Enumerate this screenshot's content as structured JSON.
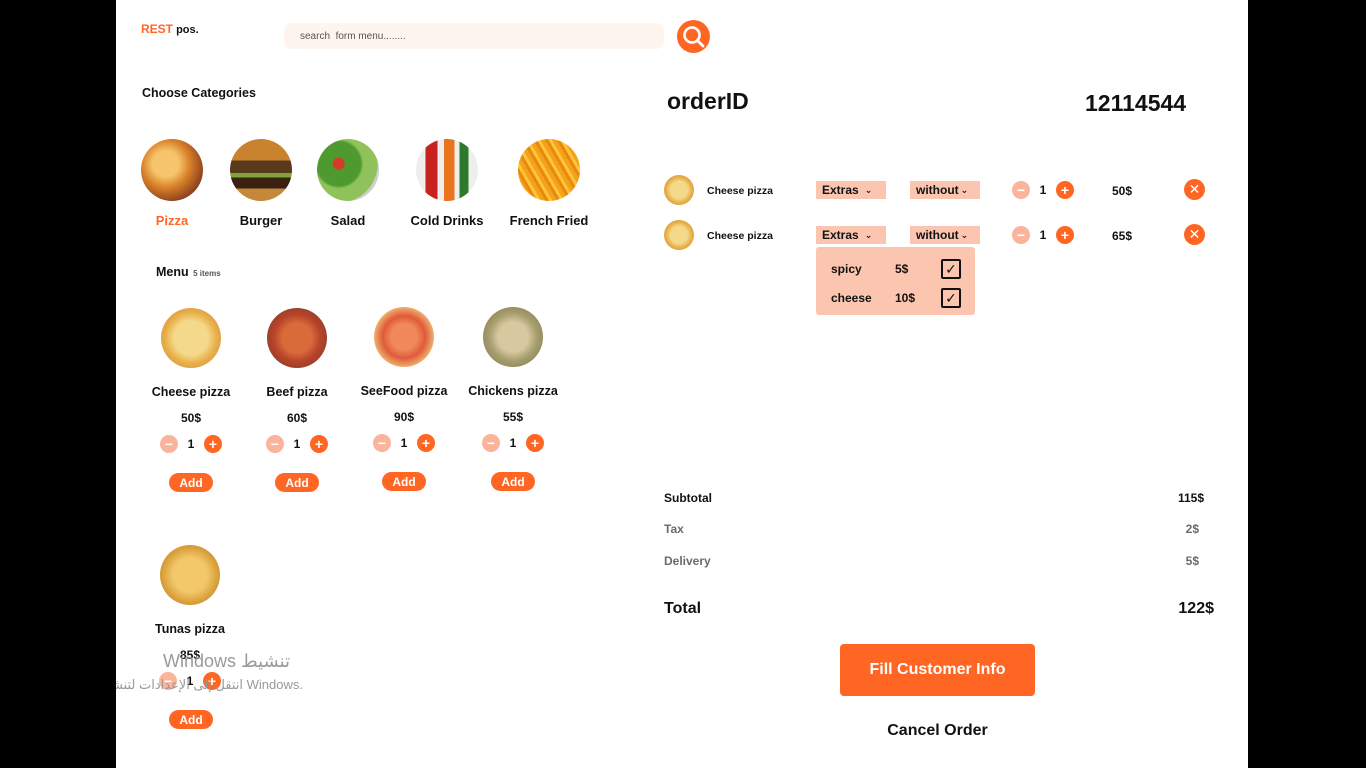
{
  "header": {
    "brand": "REST",
    "brand_suffix": "pos.",
    "search_placeholder": "search  form menu........"
  },
  "categories": {
    "title": "Choose Categories",
    "items": [
      {
        "label": "Pizza",
        "active": true
      },
      {
        "label": "Burger",
        "active": false
      },
      {
        "label": "Salad",
        "active": false
      },
      {
        "label": "Cold Drinks",
        "active": false
      },
      {
        "label": "French Fried",
        "active": false
      }
    ]
  },
  "menu": {
    "title": "Menu",
    "count": "5 items",
    "add_label": "Add",
    "items": [
      {
        "name": "Cheese pizza",
        "price": "50$",
        "qty": "1"
      },
      {
        "name": "Beef pizza",
        "price": "60$",
        "qty": "1"
      },
      {
        "name": "SeeFood pizza",
        "price": "90$",
        "qty": "1"
      },
      {
        "name": "Chickens pizza",
        "price": "55$",
        "qty": "1"
      },
      {
        "name": "Tunas pizza",
        "price": "85$",
        "qty": "1"
      }
    ]
  },
  "order": {
    "title": "orderID",
    "id": "12114544",
    "extras_label": "Extras",
    "without_label": "without",
    "items": [
      {
        "name": "Cheese pizza",
        "qty": "1",
        "price": "50$"
      },
      {
        "name": "Cheese pizza",
        "qty": "1",
        "price": "65$"
      }
    ],
    "extras_options": [
      {
        "name": "spicy",
        "price": "5$",
        "checked": true
      },
      {
        "name": "cheese",
        "price": "10$",
        "checked": true
      }
    ]
  },
  "summary": {
    "subtotal_label": "Subtotal",
    "subtotal": "115$",
    "tax_label": "Tax",
    "tax": "2$",
    "delivery_label": "Delivery",
    "delivery": "5$",
    "total_label": "Total",
    "total": "122$"
  },
  "actions": {
    "fill_label": "Fill  Customer Info",
    "cancel_label": "Cancel Order"
  },
  "watermark": {
    "line1": "Windows تنشيط",
    "line2": "انتقل إلى الإعدادات لتنشيط Windows."
  },
  "colors": {
    "accent": "#ff6624",
    "accent_soft": "#fbb49c",
    "chip": "#fbc5b0",
    "search_bg": "#fff5ef"
  }
}
